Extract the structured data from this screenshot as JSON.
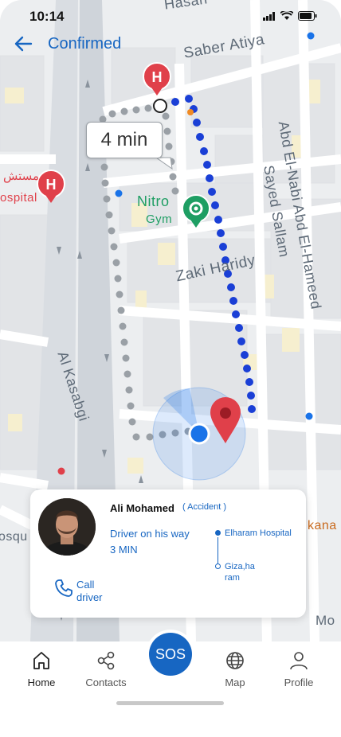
{
  "status_bar": {
    "time": "10:14"
  },
  "header": {
    "title": "Confirmed"
  },
  "map": {
    "streets": [
      "Hasan",
      "Saber Atiya",
      "Abd El-Nabi Abd El-Hameed",
      "Sayed Sallam",
      "Zaki Haridy",
      "Al Kasabgi"
    ],
    "places": {
      "gym": "Nitro",
      "gym_sub": "Gym",
      "hospital_left": "ospital",
      "hospital_arabic": "مستش"
    },
    "edge_labels": {
      "left": "osqu",
      "right": "kana",
      "bottom_right": "Mo"
    },
    "eta": "4 min"
  },
  "card": {
    "driver_name": "Ali Mohamed",
    "badge": "( Accident )",
    "status_line1": "Driver on his way",
    "status_line2": "3 MIN",
    "route_from": "Elharam Hospital",
    "route_to": "Giza,ha ram",
    "call_label": "Call driver"
  },
  "nav": {
    "sos": "SOS",
    "items": [
      {
        "label": "Home",
        "icon": "home-icon"
      },
      {
        "label": "Contacts",
        "icon": "share-icon"
      },
      {
        "label": "Map",
        "icon": "globe-icon"
      },
      {
        "label": "Profile",
        "icon": "person-icon"
      }
    ]
  },
  "colors": {
    "accent": "#1766c2",
    "route_blue": "#1a3fd6",
    "hospital_red": "#e0404a",
    "gym_green": "#1e9e63"
  }
}
